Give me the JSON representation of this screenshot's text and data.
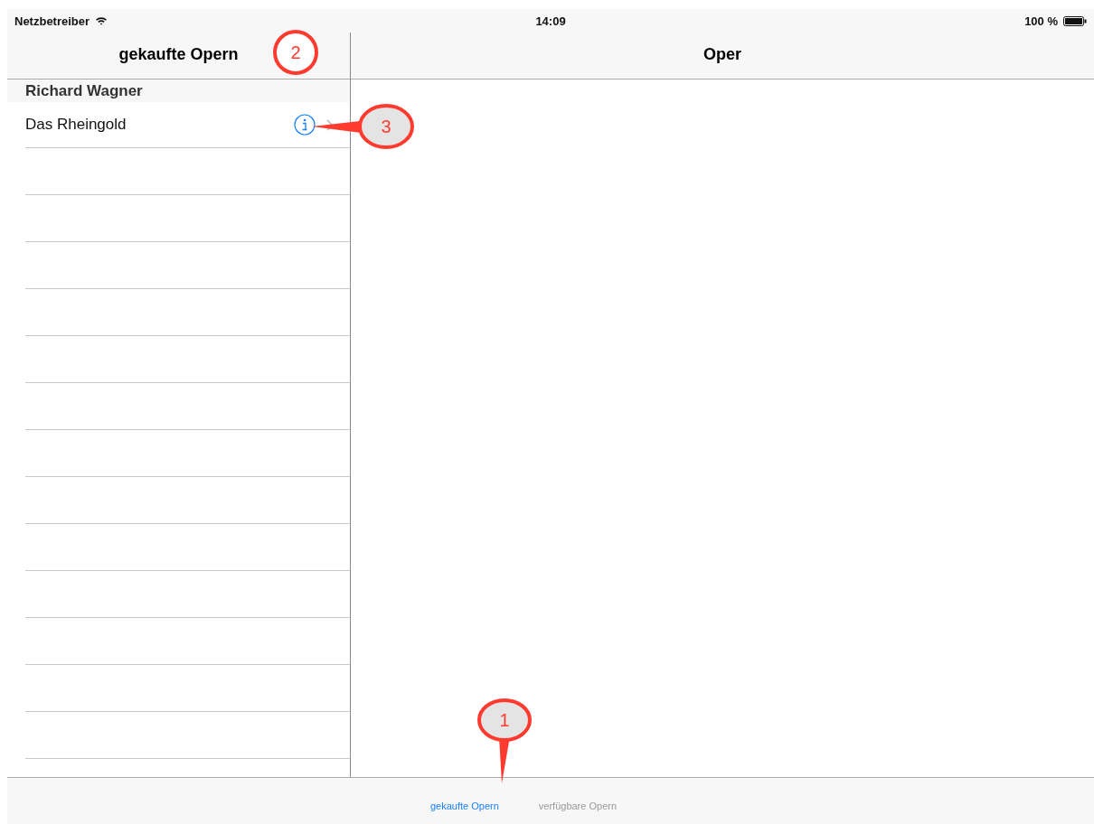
{
  "status_bar": {
    "carrier": "Netzbetreiber",
    "time": "14:09",
    "battery": "100 %"
  },
  "master": {
    "title": "gekaufte Opern",
    "sections": [
      {
        "header": "Richard Wagner",
        "rows": [
          {
            "title": "Das Rheingold",
            "info": true,
            "disclosure": true
          }
        ]
      }
    ]
  },
  "detail": {
    "title": "Oper"
  },
  "tab_bar": [
    {
      "label": "gekaufte Opern",
      "selected": true
    },
    {
      "label": "verfügbare Opern",
      "selected": false
    }
  ],
  "callouts": [
    {
      "number": "1",
      "kind": "pointer-down"
    },
    {
      "number": "2",
      "kind": "ring"
    },
    {
      "number": "3",
      "kind": "pointer-left"
    }
  ]
}
